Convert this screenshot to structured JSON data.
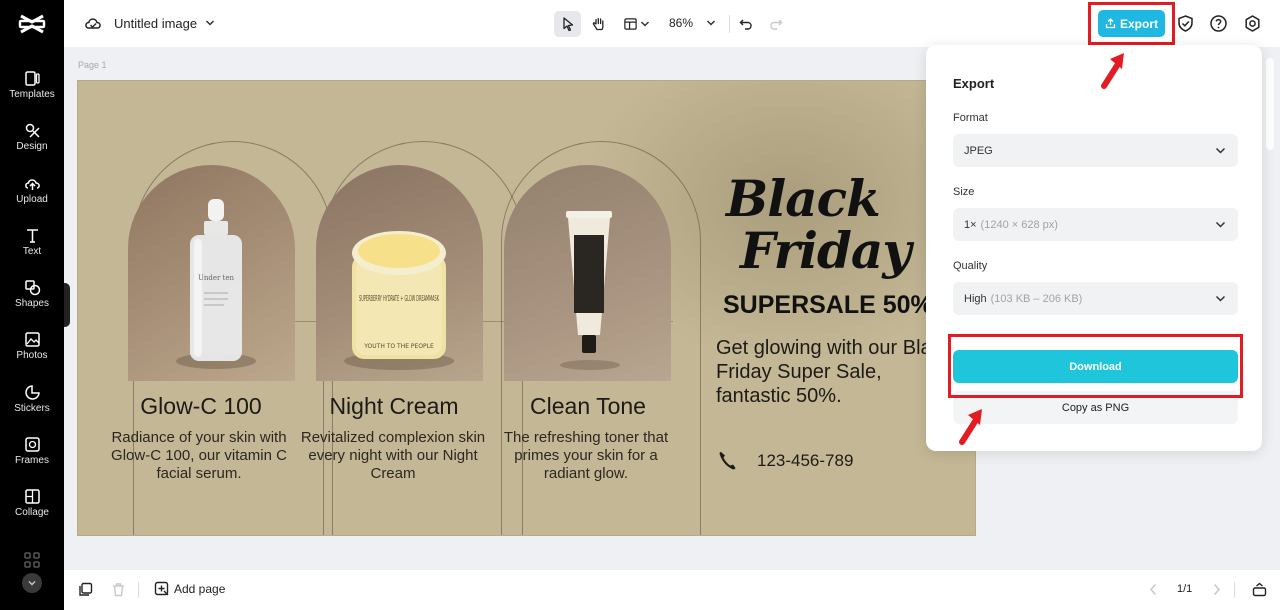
{
  "sidebar": {
    "items": [
      {
        "label": "Templates",
        "icon": "templates-icon"
      },
      {
        "label": "Design",
        "icon": "design-icon"
      },
      {
        "label": "Upload",
        "icon": "upload-icon"
      },
      {
        "label": "Text",
        "icon": "text-icon"
      },
      {
        "label": "Shapes",
        "icon": "shapes-icon"
      },
      {
        "label": "Photos",
        "icon": "photos-icon"
      },
      {
        "label": "Stickers",
        "icon": "stickers-icon"
      },
      {
        "label": "Frames",
        "icon": "frames-icon"
      },
      {
        "label": "Collage",
        "icon": "collage-icon"
      }
    ]
  },
  "header": {
    "doc_title": "Untitled image",
    "zoom": "86%",
    "export_label": "Export"
  },
  "canvas": {
    "page_label": "Page 1",
    "products": [
      {
        "name": "Glow-C 100",
        "desc": "Radiance of your skin with Glow-C 100, our vitamin C facial serum."
      },
      {
        "name": "Night Cream",
        "desc": "Revitalized complexion skin every night with our Night Cream"
      },
      {
        "name": "Clean Tone",
        "desc": "The refreshing toner that primes your skin for a radiant glow."
      }
    ],
    "headline_1": "Black",
    "headline_2": "Friday",
    "supersale": "SUPERSALE 50%",
    "tagline": "Get glowing with our Black Friday Super Sale, fantastic 50%.",
    "phone": "123-456-789",
    "serum_label": "Under ten",
    "jar_label": "SUPERBERRY HYDRATE + GLOW DREAMMASK",
    "jar_brand": "YOUTH TO THE PEOPLE"
  },
  "export_panel": {
    "title": "Export",
    "format_label": "Format",
    "format_value": "JPEG",
    "size_label": "Size",
    "size_value": "1×",
    "size_detail": "(1240 × 628 px)",
    "quality_label": "Quality",
    "quality_value": "High",
    "quality_detail": "(103 KB – 206 KB)",
    "download_label": "Download",
    "copy_label": "Copy as PNG"
  },
  "footer": {
    "add_page_label": "Add page",
    "pager": "1/1"
  },
  "colors": {
    "accent": "#1fb8e2",
    "download": "#1fc5da",
    "highlight": "#e31b23",
    "canvas_bg": "#c4b795"
  }
}
